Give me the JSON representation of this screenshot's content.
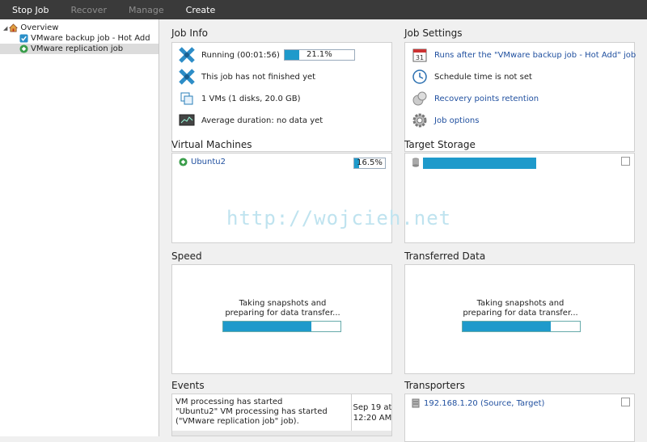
{
  "toolbar": {
    "stop_job": "Stop Job",
    "recover": "Recover",
    "manage": "Manage",
    "create": "Create"
  },
  "tree": {
    "overview": "Overview",
    "backup_job": "VMware backup job - Hot Add",
    "replication_job": "VMware replication job"
  },
  "job_info": {
    "title": "Job Info",
    "running": "Running (00:01:56)",
    "progress_text": "21.1%",
    "progress": 0.211,
    "not_finished": "This job has not finished yet",
    "vms": "1 VMs (1 disks, 20.0 GB)",
    "avg_duration": "Average duration: no data yet"
  },
  "job_settings": {
    "title": "Job Settings",
    "runs_after": "Runs after the \"VMware backup job - Hot Add\" job",
    "schedule": "Schedule time is not set",
    "recovery_points": "Recovery points retention",
    "job_options": "Job options"
  },
  "virtual_machines": {
    "title": "Virtual Machines",
    "vm_name": "Ubuntu2",
    "progress_text": "16.5%",
    "progress": 0.165
  },
  "target_storage": {
    "title": "Target Storage",
    "progress": 1.0
  },
  "speed": {
    "title": "Speed",
    "message_line1": "Taking snapshots and",
    "message_line2": "preparing for data transfer...",
    "progress": 0.75
  },
  "transferred": {
    "title": "Transferred Data",
    "message_line1": "Taking snapshots and",
    "message_line2": "preparing for data transfer...",
    "progress": 0.75
  },
  "events": {
    "title": "Events",
    "line1": "VM processing has started",
    "line2": "\"Ubuntu2\" VM processing has started",
    "line3": "(\"VMware replication job\" job).",
    "date": "Sep 19 at",
    "time": "12:20 AM"
  },
  "transporters": {
    "title": "Transporters",
    "entry": "192.168.1.20 (Source, Target)"
  },
  "watermark": "http://wojcieh.net",
  "colors": {
    "toolbar_bg": "#3a3a3a",
    "progress_fill": "#1e9acb",
    "link": "#1f4f9f"
  }
}
